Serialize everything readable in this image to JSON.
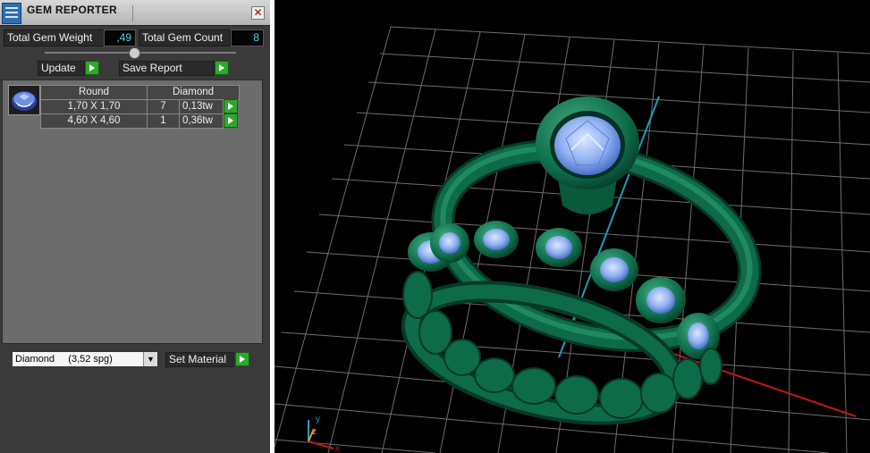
{
  "panel": {
    "title": "GEM REPORTER",
    "close_glyph": "✕",
    "total_gem_weight_label": "Total Gem Weight",
    "total_gem_weight_value": ",49",
    "total_gem_count_label": "Total Gem Count",
    "total_gem_count_value": "8",
    "update_label": "Update",
    "save_report_label": "Save Report",
    "table": {
      "headers": [
        "Round",
        "Diamond"
      ],
      "rows": [
        {
          "size": "1,70 X 1,70",
          "count": "7",
          "weight": "0,13tw"
        },
        {
          "size": "4,60 X 4,60",
          "count": "1",
          "weight": "0,36tw"
        }
      ]
    },
    "material": {
      "selected": "Diamond     (3,52 spg)",
      "set_label": "Set Material"
    }
  },
  "viewport": {
    "axis_x": "x",
    "axis_y": "y",
    "axis_z": "z",
    "colors": {
      "background": "#000000",
      "grid": "#8a8a8a",
      "metal": "#0e6b4a",
      "gem": "#8fb4f0",
      "x_axis": "#c01818",
      "y_axis": "#1aa0b0"
    }
  }
}
